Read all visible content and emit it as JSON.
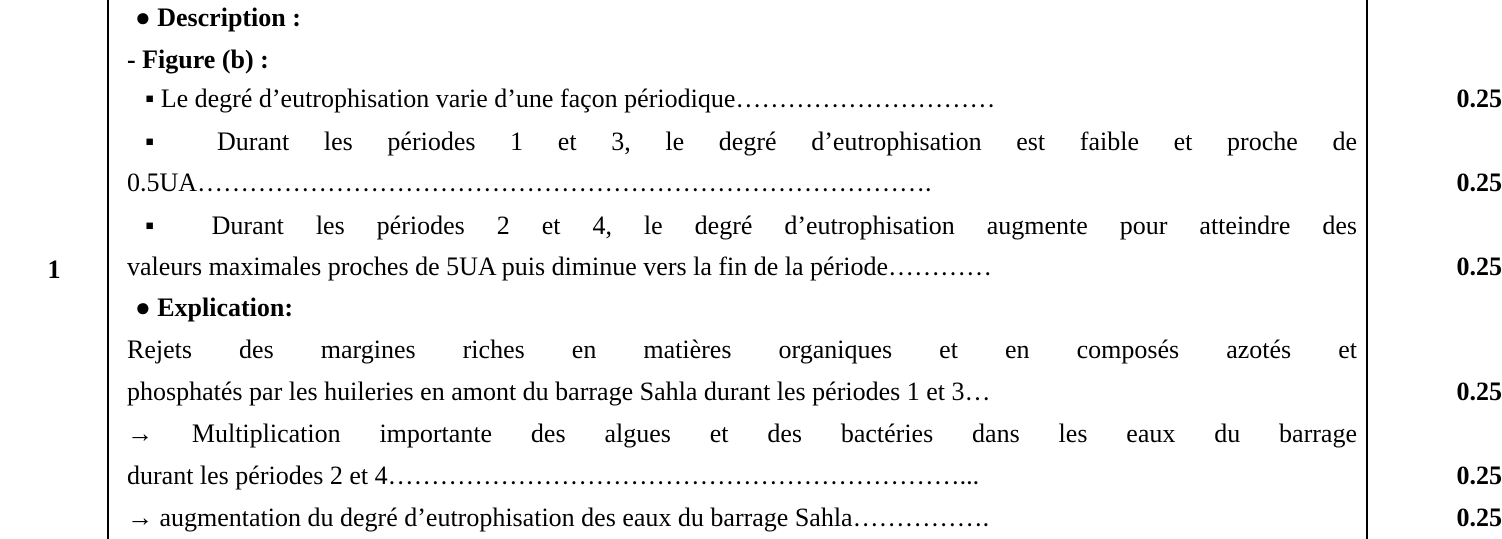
{
  "question_number": "1",
  "description": {
    "heading": "● Description :",
    "figure_label": "- Figure (b) :",
    "lines": [
      "▪ Le degré d’eutrophisation  varie d’une façon périodique…………………………",
      "▪ Durant les périodes  1 et 3, le degré d’eutrophisation est faible et proche de",
      "0.5UA………………………………………………………………………….",
      "▪ Durant les périodes 2 et 4, le degré d’eutrophisation augmente pour atteindre des",
      "valeurs maximales proches de 5UA puis diminue vers la fin de la période…………"
    ]
  },
  "explication": {
    "heading": "● Explication:",
    "lines": [
      "Rejets des margines riches en matières organiques et en composés azotés et",
      "phosphatés par les huileries en amont du barrage Sahla durant les périodes 1 et 3…",
      "→ Multiplication importante des algues et des bactéries dans les eaux du barrage",
      "durant les périodes 2 et 4…………………………………………………………...",
      "→ augmentation du degré d’eutrophisation des eaux du barrage Sahla……………."
    ]
  },
  "scores": [
    "0.25",
    "0.25",
    "0.25",
    "0.25",
    "0.25",
    "0.25"
  ]
}
